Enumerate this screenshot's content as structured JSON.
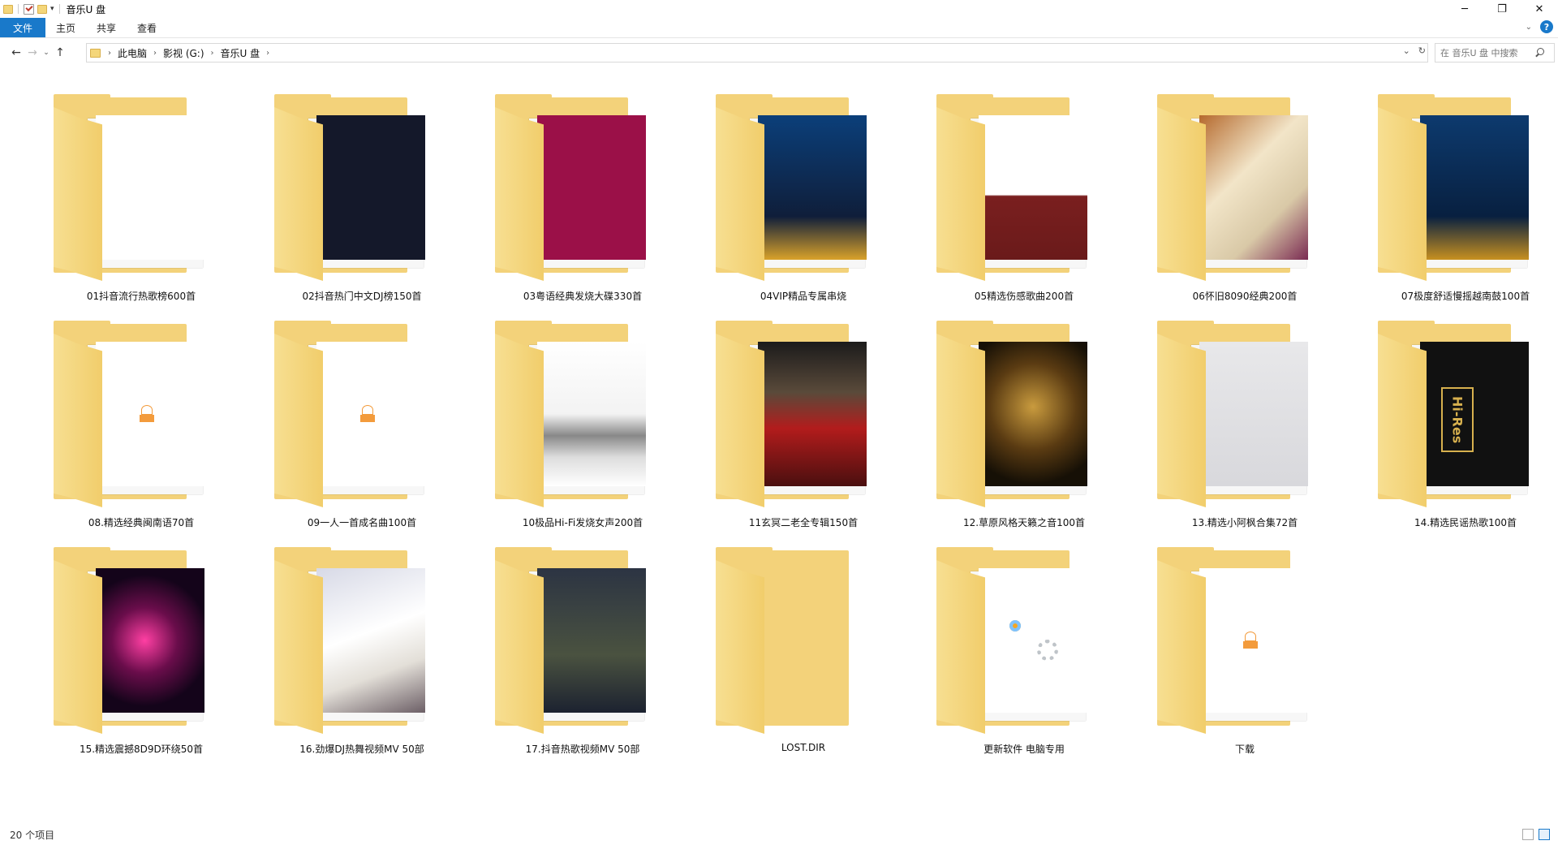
{
  "window": {
    "title": "音乐U 盘",
    "controls": {
      "minimize": "─",
      "restore": "❐",
      "close": "✕"
    }
  },
  "ribbon": {
    "tabs": [
      {
        "label": "文件",
        "active": true
      },
      {
        "label": "主页"
      },
      {
        "label": "共享"
      },
      {
        "label": "查看"
      }
    ],
    "help_label": "?"
  },
  "nav": {
    "back": "←",
    "forward": "→",
    "recent": "⌄",
    "up": "↑"
  },
  "address": {
    "crumbs": [
      "此电脑",
      "影视 (G:)",
      "音乐U 盘"
    ],
    "separator": "›",
    "dropdown": "⌄",
    "refresh": "↻"
  },
  "search": {
    "placeholder": "在 音乐U 盘 中搜索"
  },
  "folders": [
    {
      "name": "01抖音流行热歌榜600首",
      "icon": "folder-icon",
      "thumb": "blank"
    },
    {
      "name": "02抖音热门中文DJ榜150首",
      "icon": "folder-icon",
      "thumb": "dark"
    },
    {
      "name": "03粤语经典发烧大碟330首",
      "icon": "folder-icon",
      "thumb": "mag"
    },
    {
      "name": "04VIP精品专属串烧",
      "icon": "folder-icon",
      "thumb": "blue"
    },
    {
      "name": "05精选伤感歌曲200首",
      "icon": "folder-icon",
      "thumb": "person"
    },
    {
      "name": "06怀旧8090经典200首",
      "icon": "folder-icon",
      "thumb": "cube"
    },
    {
      "name": "07极度舒适慢摇越南鼓100首",
      "icon": "folder-icon",
      "thumb": "blue2"
    },
    {
      "name": "08.精选经典闽南语70首",
      "icon": "folder-icon",
      "thumb": "logo"
    },
    {
      "name": "09一人一首成名曲100首",
      "icon": "folder-icon",
      "thumb": "logo"
    },
    {
      "name": "10极品Hi-Fi发烧女声200首",
      "icon": "folder-icon",
      "thumb": "sketch"
    },
    {
      "name": "11玄冥二老全专辑150首",
      "icon": "folder-icon",
      "thumb": "bald"
    },
    {
      "name": "12.草原风格天籁之音100首",
      "icon": "folder-icon",
      "thumb": "gold"
    },
    {
      "name": "13.精选小阿枫合集72首",
      "icon": "folder-icon",
      "thumb": "sand"
    },
    {
      "name": "14.精选民谣热歌100首",
      "icon": "folder-icon",
      "thumb": "hires"
    },
    {
      "name": "15.精选震撼8D9D环绕50首",
      "icon": "folder-icon",
      "thumb": "dj"
    },
    {
      "name": "16.劲爆DJ热舞视频MV 50部",
      "icon": "folder-icon",
      "thumb": "pale"
    },
    {
      "name": "17.抖音热歌视频MV 50部",
      "icon": "folder-icon",
      "thumb": "night"
    },
    {
      "name": "LOST.DIR",
      "icon": "folder-icon",
      "thumb": "empty"
    },
    {
      "name": "更新软件 电脑专用",
      "icon": "folder-icon",
      "thumb": "software"
    },
    {
      "name": "下载",
      "icon": "folder-icon",
      "thumb": "logo"
    }
  ],
  "thumb_text": {
    "hires_badge": "Hi-Res"
  },
  "status": {
    "count_text": "20 个项目"
  }
}
